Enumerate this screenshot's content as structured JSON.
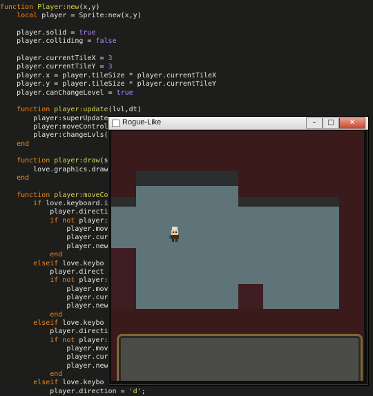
{
  "editor": {
    "lines": [
      [
        [
          "kw",
          "function "
        ],
        [
          "fn",
          "Player:new"
        ],
        [
          "plain",
          "(x,y)"
        ]
      ],
      [
        [
          "plain",
          "    "
        ],
        [
          "kw",
          "local "
        ],
        [
          "plain",
          "player = Sprite:new(x,y)"
        ]
      ],
      [],
      [
        [
          "plain",
          "    player.solid = "
        ],
        [
          "bool",
          "true"
        ]
      ],
      [
        [
          "plain",
          "    player.colliding = "
        ],
        [
          "bool",
          "false"
        ]
      ],
      [],
      [
        [
          "plain",
          "    player.currentTileX = "
        ],
        [
          "num",
          "3"
        ]
      ],
      [
        [
          "plain",
          "    player.currentTileY = "
        ],
        [
          "num",
          "3"
        ]
      ],
      [
        [
          "plain",
          "    player.x = player.tileSize * player.currentTileX"
        ]
      ],
      [
        [
          "plain",
          "    player.y = player.tileSize * player.currentTileY"
        ]
      ],
      [
        [
          "plain",
          "    player.canChangeLevel = "
        ],
        [
          "bool",
          "true"
        ]
      ],
      [],
      [
        [
          "plain",
          "    "
        ],
        [
          "kw",
          "function "
        ],
        [
          "fn",
          "player:update"
        ],
        [
          "plain",
          "(lvl,dt)"
        ]
      ],
      [
        [
          "plain",
          "        player:superUpdate"
        ]
      ],
      [
        [
          "plain",
          "        player:moveControl"
        ]
      ],
      [
        [
          "plain",
          "        player:changeLvls("
        ]
      ],
      [
        [
          "plain",
          "    "
        ],
        [
          "kw",
          "end"
        ]
      ],
      [],
      [
        [
          "plain",
          "    "
        ],
        [
          "kw",
          "function "
        ],
        [
          "fn",
          "player:draw"
        ],
        [
          "plain",
          "(s"
        ]
      ],
      [
        [
          "plain",
          "        love.graphics.draw"
        ]
      ],
      [
        [
          "plain",
          "    "
        ],
        [
          "kw",
          "end"
        ]
      ],
      [],
      [
        [
          "plain",
          "    "
        ],
        [
          "kw",
          "function "
        ],
        [
          "fn",
          "player:moveCo"
        ]
      ],
      [
        [
          "plain",
          "        "
        ],
        [
          "kw",
          "if "
        ],
        [
          "plain",
          "love.keyboard.i"
        ]
      ],
      [
        [
          "plain",
          "            player.directio"
        ]
      ],
      [
        [
          "plain",
          "            "
        ],
        [
          "kw",
          "if not "
        ],
        [
          "plain",
          "player:"
        ]
      ],
      [
        [
          "plain",
          "                player.mov"
        ]
      ],
      [
        [
          "plain",
          "                player.cur"
        ]
      ],
      [
        [
          "plain",
          "                player.new"
        ]
      ],
      [
        [
          "plain",
          "            "
        ],
        [
          "kw",
          "end"
        ]
      ],
      [
        [
          "plain",
          "        "
        ],
        [
          "kw",
          "elseif "
        ],
        [
          "plain",
          "love.keybo"
        ]
      ],
      [
        [
          "plain",
          "            player.direct"
        ]
      ],
      [
        [
          "plain",
          "            "
        ],
        [
          "kw",
          "if not "
        ],
        [
          "plain",
          "player:"
        ]
      ],
      [
        [
          "plain",
          "                player.mov"
        ]
      ],
      [
        [
          "plain",
          "                player.cur"
        ]
      ],
      [
        [
          "plain",
          "                player.new"
        ]
      ],
      [
        [
          "plain",
          "            "
        ],
        [
          "kw",
          "end"
        ]
      ],
      [
        [
          "plain",
          "        "
        ],
        [
          "kw",
          "elseif "
        ],
        [
          "plain",
          "love.keybo"
        ]
      ],
      [
        [
          "plain",
          "            player.directi"
        ]
      ],
      [
        [
          "plain",
          "            "
        ],
        [
          "kw",
          "if not "
        ],
        [
          "plain",
          "player:"
        ]
      ],
      [
        [
          "plain",
          "                player.mov"
        ]
      ],
      [
        [
          "plain",
          "                player.cur"
        ]
      ],
      [
        [
          "plain",
          "                player.new"
        ]
      ],
      [
        [
          "plain",
          "            "
        ],
        [
          "kw",
          "end"
        ]
      ],
      [
        [
          "plain",
          "        "
        ],
        [
          "kw",
          "elseif "
        ],
        [
          "plain",
          "love.keybo"
        ]
      ],
      [
        [
          "plain",
          "            player.direction = "
        ],
        [
          "str",
          "'d'"
        ],
        [
          "plain",
          ";"
        ]
      ]
    ],
    "colors": {
      "keyword": "#f3851f",
      "function": "#d6d24a",
      "constant": "#b186ff",
      "string": "#dcd27a",
      "text": "#e8e8e2",
      "background": "#1d1e1b"
    }
  },
  "window": {
    "title": "Rogue-Like",
    "controls": {
      "minimize": "–",
      "maximize": "□",
      "close": "✕"
    }
  }
}
